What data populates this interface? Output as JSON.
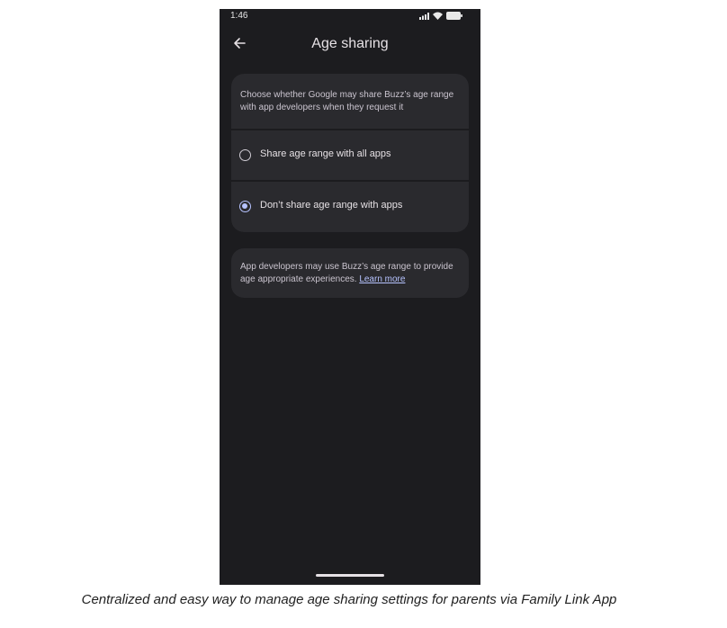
{
  "status_bar": {
    "time": "1:46"
  },
  "app_bar": {
    "title": "Age sharing"
  },
  "settings_card": {
    "description": "Choose whether Google may share Buzz’s age range with app developers when they request it",
    "options": [
      {
        "label": "Share age range with all apps",
        "selected": false
      },
      {
        "label": "Don’t share age range with apps",
        "selected": true
      }
    ]
  },
  "info_card": {
    "text": "App developers may use Buzz’s age range to provide age appropriate experiences.",
    "link_label": "Learn more"
  },
  "caption": "Centralized and easy way to manage age sharing settings for parents via Family Link App",
  "colors": {
    "background": "#1c1c1f",
    "card": "#2a2a2e",
    "accent": "#b6c3ff"
  }
}
